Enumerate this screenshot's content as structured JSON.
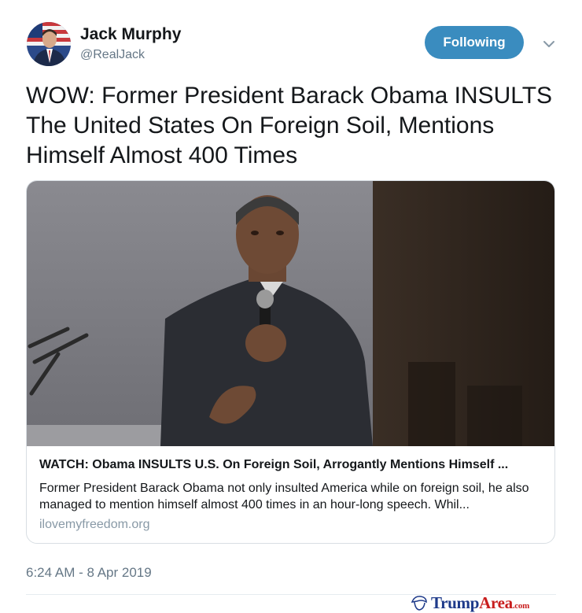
{
  "author": {
    "name": "Jack Murphy",
    "handle": "@RealJack"
  },
  "follow_button": {
    "label": "Following",
    "color": "#3a8cbf"
  },
  "menu": {
    "icon": "chevron-down-icon"
  },
  "tweet": {
    "text": "WOW: Former President Barack Obama INSULTS The United States On Foreign Soil, Mentions Himself Almost 400 Times",
    "timestamp": "6:24 AM - 8 Apr 2019"
  },
  "link_card": {
    "title": "WATCH: Obama INSULTS U.S. On Foreign Soil, Arrogantly Mentions Himself ...",
    "description": "Former President Barack Obama not only insulted America while on foreign soil, he also managed to mention himself almost 400 times in an hour-long speech. Whil...",
    "domain": "ilovemyfreedom.org"
  },
  "watermark": {
    "brand_main": "Trump",
    "brand_accent": "Area",
    "brand_suffix": ".com"
  }
}
